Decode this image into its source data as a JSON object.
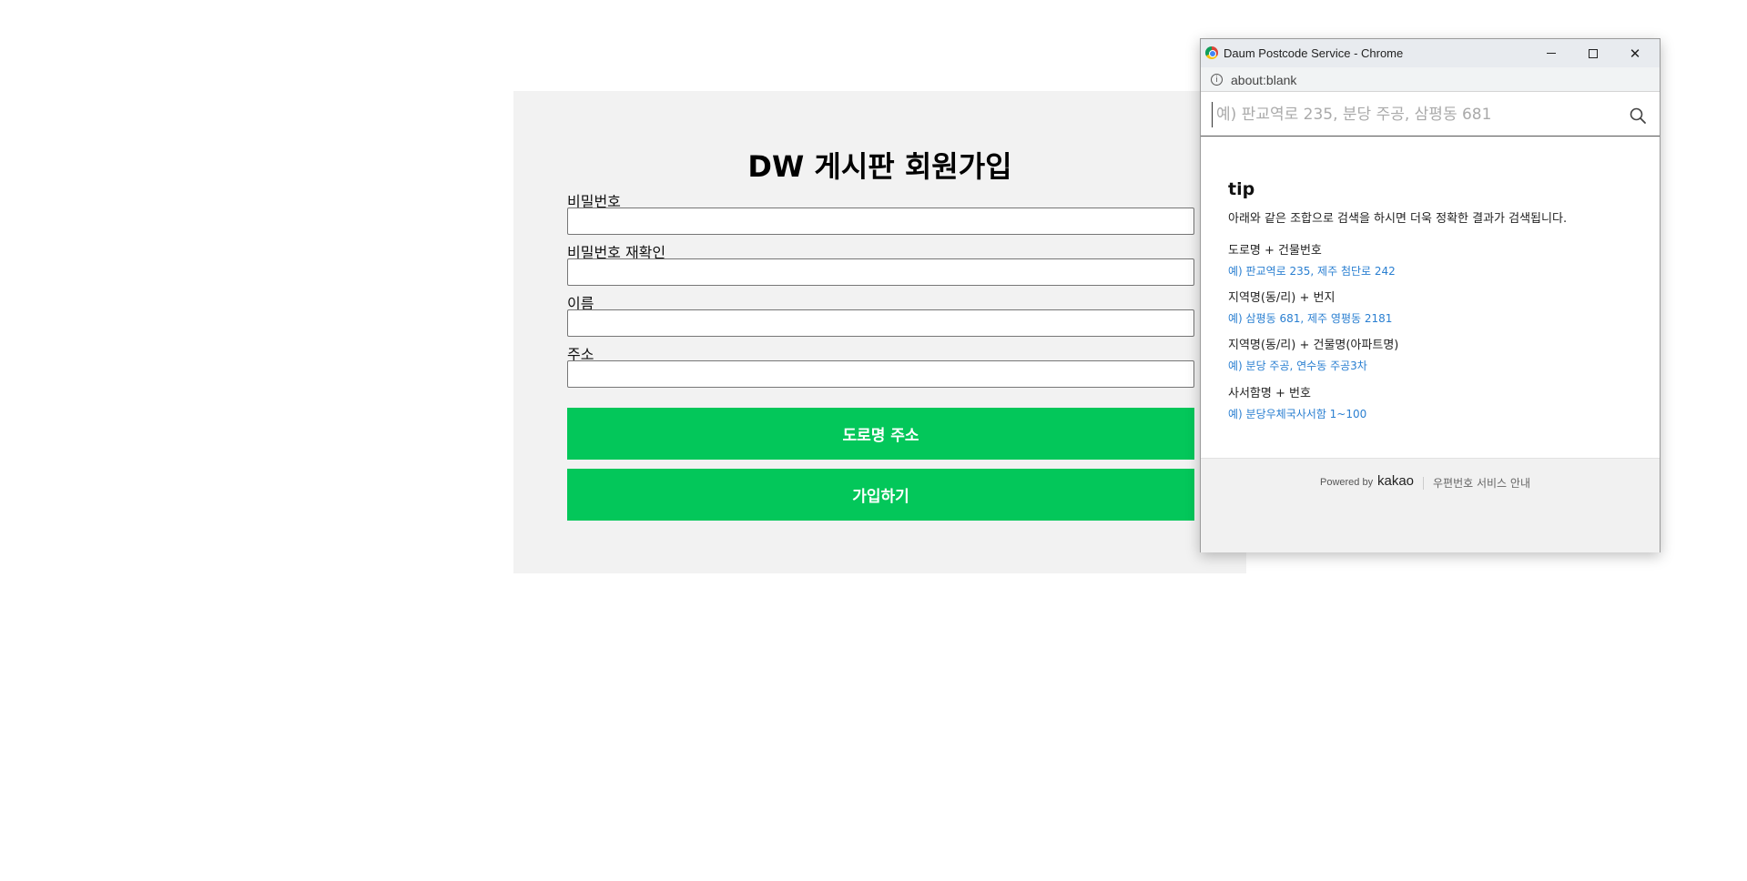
{
  "signup": {
    "title": "DW 게시판 회원가입",
    "fields": [
      {
        "label": "비밀번호",
        "value": ""
      },
      {
        "label": "비밀번호 재확인",
        "value": ""
      },
      {
        "label": "이름",
        "value": ""
      },
      {
        "label": "주소",
        "value": ""
      }
    ],
    "address_button": "도로명 주소",
    "submit_button": "가입하기",
    "colors": {
      "card_bg": "#f2f2f2",
      "button_bg": "#03c75a"
    }
  },
  "popup": {
    "window_title": "Daum Postcode Service - Chrome",
    "url": "about:blank",
    "search_placeholder": "예) 판교역로 235, 분당 주공, 삼평동 681",
    "tip": {
      "title": "tip",
      "description": "아래와 같은 조합으로 검색을 하시면 더욱 정확한 결과가 검색됩니다.",
      "items": [
        {
          "heading": "도로명 + 건물번호",
          "example": "예) 판교역로 235,  제주 첨단로 242"
        },
        {
          "heading": "지역명(동/리) + 번지",
          "example": "예) 삼평동 681,  제주 영평동 2181"
        },
        {
          "heading": "지역명(동/리) + 건물명(아파트명)",
          "example": "예) 분당 주공,  연수동 주공3차"
        },
        {
          "heading": "사서함명 + 번호",
          "example": "예) 분당우체국사서함 1~100"
        }
      ]
    },
    "footer": {
      "powered_by": "Powered by",
      "brand": "kakao",
      "service_link": "우편번호 서비스 안내"
    },
    "icons": [
      "chrome-icon",
      "minimize-icon",
      "maximize-icon",
      "close-icon",
      "info-icon",
      "search-icon"
    ],
    "colors": {
      "link": "#2a7fd1",
      "titlebar": "#e8ebef"
    }
  }
}
